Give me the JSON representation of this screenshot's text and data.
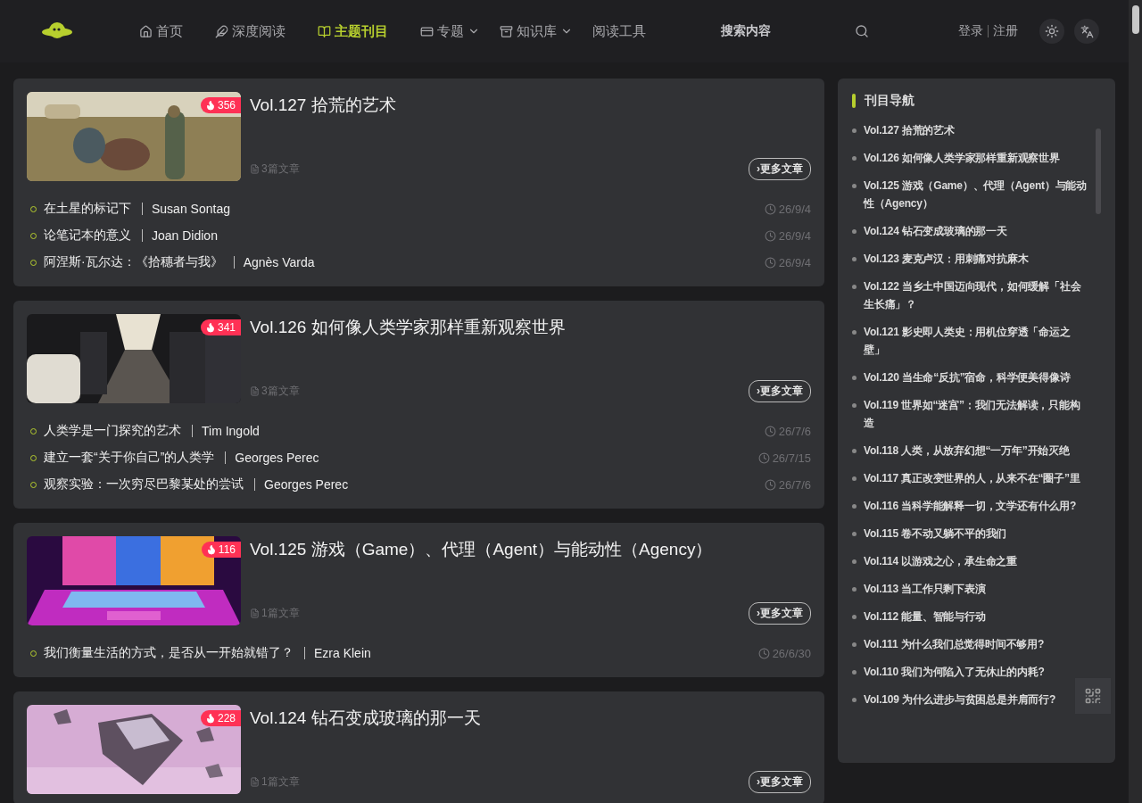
{
  "header": {
    "nav": [
      {
        "label": "首页",
        "dropdown": false,
        "selected": false
      },
      {
        "label": "深度阅读",
        "dropdown": false,
        "selected": false
      },
      {
        "label": "主题刊目",
        "dropdown": false,
        "selected": true
      },
      {
        "label": "专题",
        "dropdown": true,
        "selected": false
      },
      {
        "label": "知识库",
        "dropdown": true,
        "selected": false
      },
      {
        "label": "阅读工具",
        "dropdown": false,
        "selected": false
      }
    ],
    "search": {
      "placeholder": "搜索内容"
    },
    "login": "登录",
    "register": "注册"
  },
  "issues": [
    {
      "title": "Vol.127 拾荒的艺术",
      "hot": "356",
      "count": "3篇文章",
      "more": "›更多文章",
      "articles": [
        {
          "title": "在土星的标记下",
          "author": "Susan Sontag",
          "date": "26/9/4"
        },
        {
          "title": "论笔记本的意义",
          "author": "Joan Didion",
          "date": "26/9/4"
        },
        {
          "title": "阿涅斯·瓦尔达：《拾穗者与我》",
          "author": "Agnès Varda",
          "date": "26/9/4"
        }
      ]
    },
    {
      "title": "Vol.126 如何像人类学家那样重新观察世界",
      "hot": "341",
      "count": "3篇文章",
      "more": "›更多文章",
      "articles": [
        {
          "title": "人类学是一门探究的艺术",
          "author": "Tim Ingold",
          "date": "26/7/6"
        },
        {
          "title": "建立一套“关于你自己”的人类学",
          "author": "Georges Perec",
          "date": "26/7/15"
        },
        {
          "title": "观察实验：一次穷尽巴黎某处的尝试",
          "author": "Georges Perec",
          "date": "26/7/6"
        }
      ]
    },
    {
      "title": "Vol.125 游戏（Game）、代理（Agent）与能动性（Agency）",
      "hot": "116",
      "count": "1篇文章",
      "more": "›更多文章",
      "articles": [
        {
          "title": "我们衡量生活的方式，是否从一开始就错了？",
          "author": "Ezra Klein",
          "date": "26/6/30"
        }
      ]
    },
    {
      "title": "Vol.124 钻石变成玻璃的那一天",
      "hot": "228",
      "count": "1篇文章",
      "more": "›更多文章"
    }
  ],
  "sidebar": {
    "title": "刊目导航",
    "items": [
      "Vol.127 拾荒的艺术",
      "Vol.126 如何像人类学家那样重新观察世界",
      "Vol.125 游戏（Game）、代理（Agent）与能动性（Agency）",
      "Vol.124 钻石变成玻璃的那一天",
      "Vol.123 麦克卢汉：用刺痛对抗麻木",
      "Vol.122 当乡土中国迈向现代，如何缓解「社会生长痛」？",
      "Vol.121 影史即人类史：用机位穿透「命运之壁」",
      "Vol.120 当生命“反抗”宿命，科学便美得像诗",
      "Vol.119 世界如“迷宫”：我们无法解读，只能构造",
      "Vol.118 人类，从放弃幻想“一万年”开始灭绝",
      "Vol.117 真正改变世界的人，从来不在“圈子”里",
      "Vol.116 当科学能解释一切，文学还有什么用?",
      "Vol.115 卷不动又躺不平的我们",
      "Vol.114 以游戏之心，承生命之重",
      "Vol.113 当工作只剩下表演",
      "Vol.112 能量、智能与行动",
      "Vol.111 为什么我们总觉得时间不够用?",
      "Vol.110 我们为何陷入了无休止的内耗?",
      "Vol.109 为什么进步与贫困总是并肩而行?"
    ]
  }
}
